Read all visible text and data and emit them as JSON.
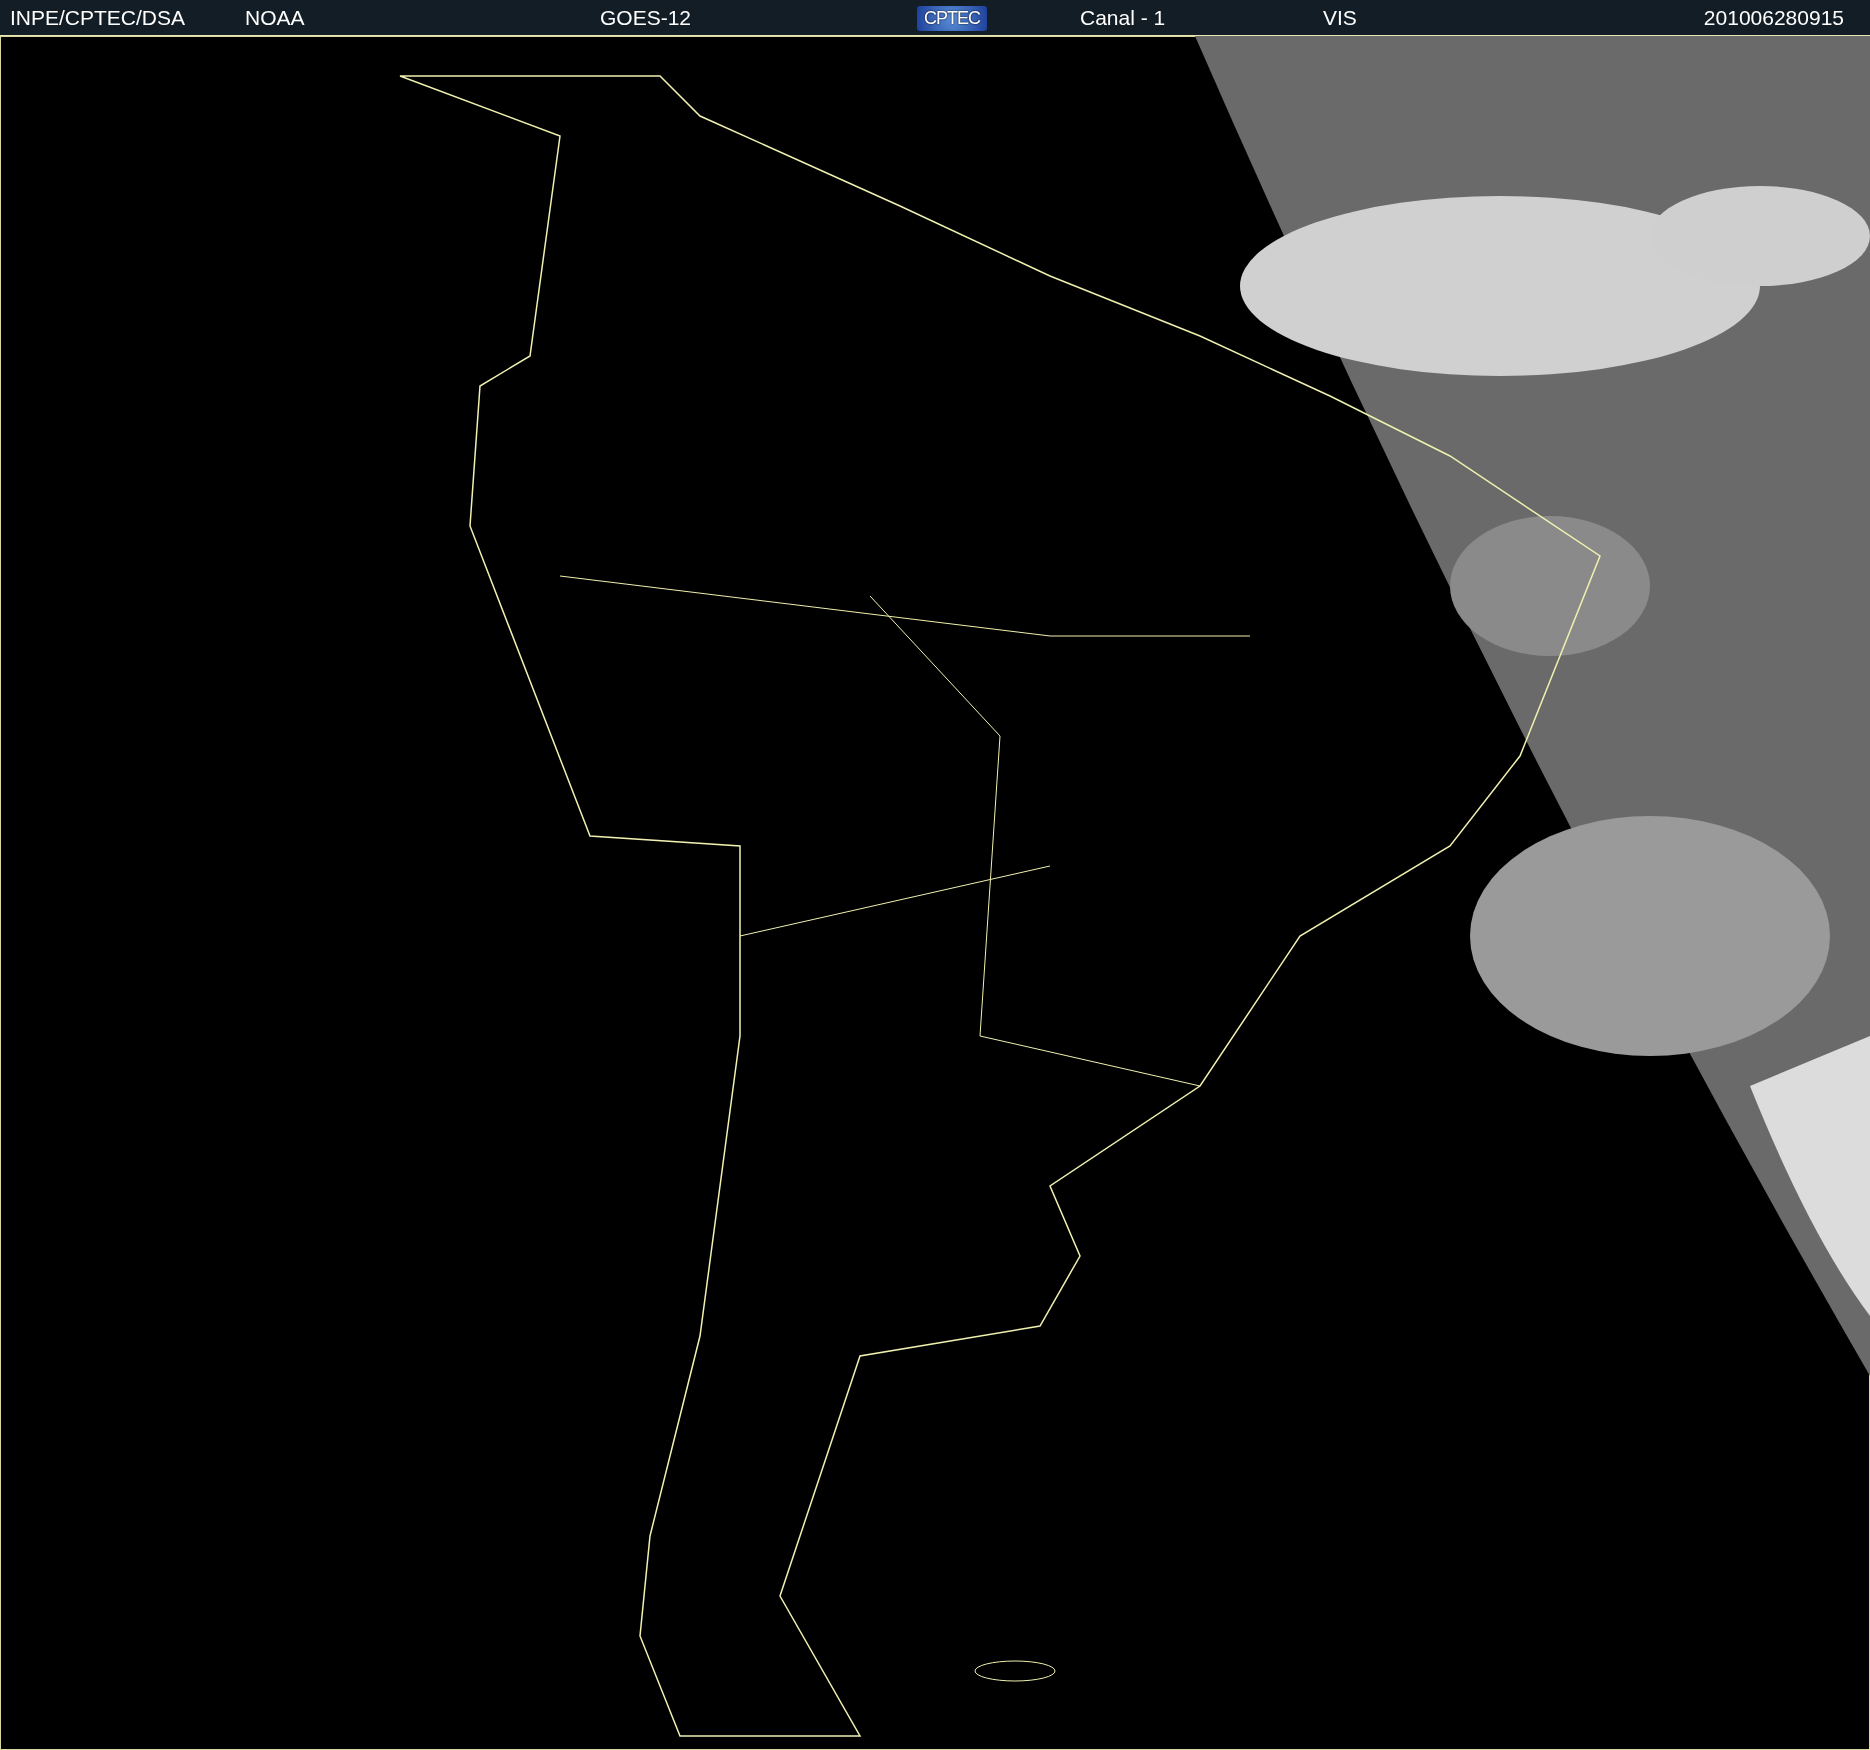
{
  "header": {
    "items": [
      {
        "kind": "text",
        "text": "INPE/CPTEC/DSA"
      },
      {
        "kind": "text",
        "text": "NOAA"
      },
      {
        "kind": "text",
        "text": "GOES-12"
      },
      {
        "kind": "logo",
        "text": "CPTEC"
      },
      {
        "kind": "text",
        "text": "Canal - 1"
      },
      {
        "kind": "text",
        "text": "VIS"
      },
      {
        "kind": "text",
        "text": "201006280915"
      }
    ]
  }
}
